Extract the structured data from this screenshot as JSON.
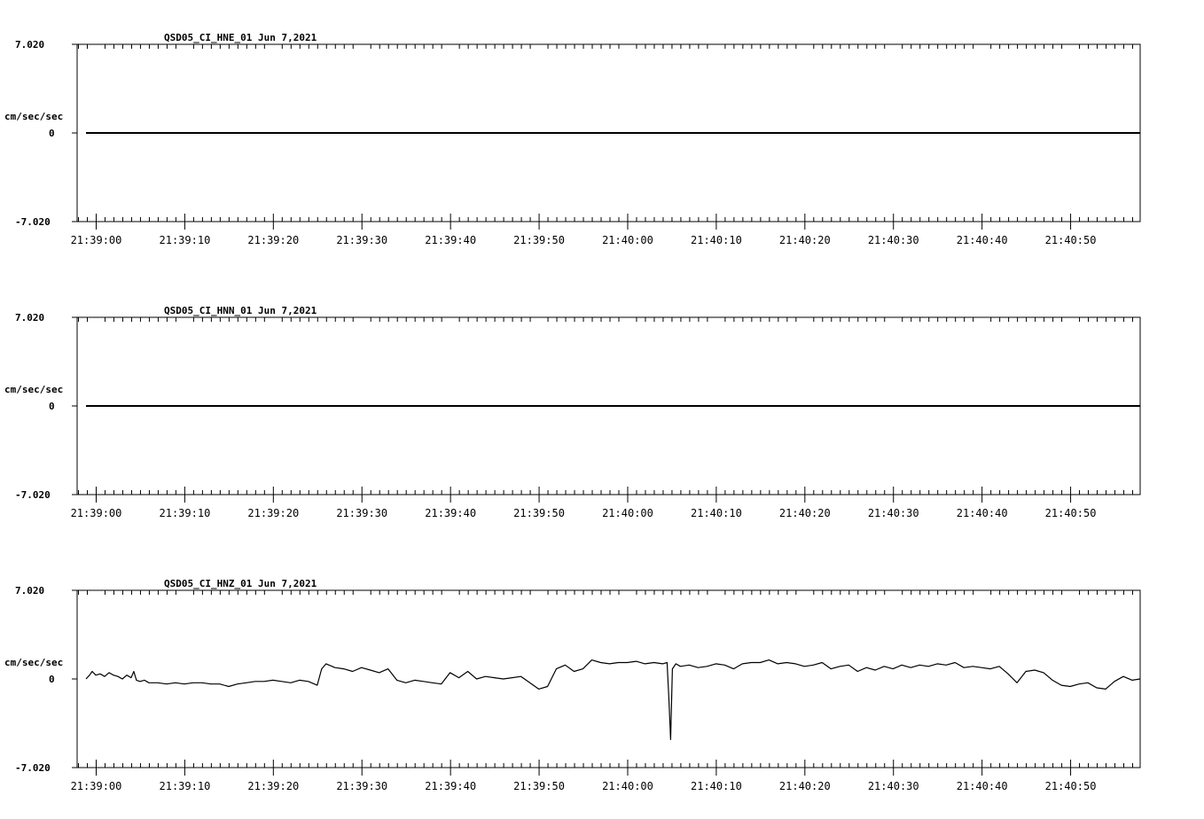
{
  "chart_data": [
    {
      "type": "line",
      "title": "QSD05_CI_HNE_01  Jun 7,2021",
      "ylabel": "cm/sec/sec",
      "ylim": [
        -7.02,
        7.02
      ],
      "y_ticks": [
        "7.020",
        "0",
        "-7.020"
      ],
      "x_ticks": [
        "21:39:00",
        "21:39:10",
        "21:39:20",
        "21:39:30",
        "21:39:40",
        "21:39:50",
        "21:40:00",
        "21:40:10",
        "21:40:20",
        "21:40:30",
        "21:40:40",
        "21:40:50"
      ],
      "xlim_seconds_after_21_38_59": [
        -1.1,
        118.9
      ],
      "series": [
        {
          "points": [
            [
              -0.1,
              0.0
            ],
            [
              118.9,
              0.0
            ]
          ]
        }
      ]
    },
    {
      "type": "line",
      "title": "QSD05_CI_HNN_01  Jun 7,2021",
      "ylabel": "cm/sec/sec",
      "ylim": [
        -7.02,
        7.02
      ],
      "y_ticks": [
        "7.020",
        "0",
        "-7.020"
      ],
      "x_ticks": [
        "21:39:00",
        "21:39:10",
        "21:39:20",
        "21:39:30",
        "21:39:40",
        "21:39:50",
        "21:40:00",
        "21:40:10",
        "21:40:20",
        "21:40:30",
        "21:40:40",
        "21:40:50"
      ],
      "xlim_seconds_after_21_38_59": [
        -1.1,
        118.9
      ],
      "series": [
        {
          "points": [
            [
              -0.1,
              0.0
            ],
            [
              118.9,
              0.0
            ]
          ]
        }
      ]
    },
    {
      "type": "line",
      "title": "QSD05_CI_HNZ_01  Jun 7,2021",
      "ylabel": "cm/sec/sec",
      "ylim": [
        -7.02,
        7.02
      ],
      "y_ticks": [
        "7.020",
        "0",
        "-7.020"
      ],
      "x_ticks": [
        "21:39:00",
        "21:39:10",
        "21:39:20",
        "21:39:30",
        "21:39:40",
        "21:39:50",
        "21:40:00",
        "21:40:10",
        "21:40:20",
        "21:40:30",
        "21:40:40",
        "21:40:50"
      ],
      "xlim_seconds_after_21_38_59": [
        -1.1,
        118.9
      ],
      "series": [
        {
          "points": [
            [
              -0.1,
              0.0
            ],
            [
              0.3,
              0.3
            ],
            [
              0.6,
              0.6
            ],
            [
              1.0,
              0.3
            ],
            [
              1.5,
              0.4
            ],
            [
              2.0,
              0.2
            ],
            [
              2.5,
              0.5
            ],
            [
              3.0,
              0.3
            ],
            [
              3.5,
              0.2
            ],
            [
              4.0,
              0.0
            ],
            [
              4.5,
              0.3
            ],
            [
              5.0,
              0.1
            ],
            [
              5.3,
              0.6
            ],
            [
              5.6,
              -0.1
            ],
            [
              6.0,
              -0.2
            ],
            [
              6.5,
              -0.1
            ],
            [
              7.0,
              -0.3
            ],
            [
              8.0,
              -0.3
            ],
            [
              9.0,
              -0.4
            ],
            [
              10.0,
              -0.3
            ],
            [
              11.0,
              -0.4
            ],
            [
              12.0,
              -0.3
            ],
            [
              13.0,
              -0.3
            ],
            [
              14.0,
              -0.4
            ],
            [
              15.0,
              -0.4
            ],
            [
              16.0,
              -0.6
            ],
            [
              17.0,
              -0.4
            ],
            [
              18.0,
              -0.3
            ],
            [
              19.0,
              -0.2
            ],
            [
              20.0,
              -0.2
            ],
            [
              21.0,
              -0.1
            ],
            [
              22.0,
              -0.2
            ],
            [
              23.0,
              -0.3
            ],
            [
              24.0,
              -0.1
            ],
            [
              25.0,
              -0.2
            ],
            [
              26.0,
              -0.5
            ],
            [
              26.5,
              0.8
            ],
            [
              27.0,
              1.2
            ],
            [
              28.0,
              0.9
            ],
            [
              29.0,
              0.8
            ],
            [
              30.0,
              0.6
            ],
            [
              31.0,
              0.9
            ],
            [
              32.0,
              0.7
            ],
            [
              33.0,
              0.5
            ],
            [
              34.0,
              0.8
            ],
            [
              35.0,
              -0.1
            ],
            [
              36.0,
              -0.3
            ],
            [
              37.0,
              -0.1
            ],
            [
              38.0,
              -0.2
            ],
            [
              39.0,
              -0.3
            ],
            [
              40.0,
              -0.4
            ],
            [
              41.0,
              0.5
            ],
            [
              42.0,
              0.1
            ],
            [
              43.0,
              0.6
            ],
            [
              44.0,
              0.0
            ],
            [
              45.0,
              0.2
            ],
            [
              46.0,
              0.1
            ],
            [
              47.0,
              0.0
            ],
            [
              48.0,
              0.1
            ],
            [
              49.0,
              0.2
            ],
            [
              50.0,
              -0.3
            ],
            [
              51.0,
              -0.8
            ],
            [
              52.0,
              -0.6
            ],
            [
              53.0,
              0.8
            ],
            [
              54.0,
              1.1
            ],
            [
              55.0,
              0.6
            ],
            [
              56.0,
              0.8
            ],
            [
              57.0,
              1.5
            ],
            [
              58.0,
              1.3
            ],
            [
              59.0,
              1.2
            ],
            [
              60.0,
              1.3
            ],
            [
              61.0,
              1.3
            ],
            [
              62.0,
              1.4
            ],
            [
              63.0,
              1.2
            ],
            [
              64.0,
              1.3
            ],
            [
              65.0,
              1.2
            ],
            [
              65.5,
              1.3
            ],
            [
              65.7,
              -1.5
            ],
            [
              65.9,
              -4.8
            ],
            [
              66.1,
              0.8
            ],
            [
              66.5,
              1.2
            ],
            [
              67.0,
              1.0
            ],
            [
              68.0,
              1.1
            ],
            [
              69.0,
              0.9
            ],
            [
              70.0,
              1.0
            ],
            [
              71.0,
              1.2
            ],
            [
              72.0,
              1.1
            ],
            [
              73.0,
              0.8
            ],
            [
              74.0,
              1.2
            ],
            [
              75.0,
              1.3
            ],
            [
              76.0,
              1.3
            ],
            [
              77.0,
              1.5
            ],
            [
              78.0,
              1.2
            ],
            [
              79.0,
              1.3
            ],
            [
              80.0,
              1.2
            ],
            [
              81.0,
              1.0
            ],
            [
              82.0,
              1.1
            ],
            [
              83.0,
              1.3
            ],
            [
              84.0,
              0.8
            ],
            [
              85.0,
              1.0
            ],
            [
              86.0,
              1.1
            ],
            [
              87.0,
              0.6
            ],
            [
              88.0,
              0.9
            ],
            [
              89.0,
              0.7
            ],
            [
              90.0,
              1.0
            ],
            [
              91.0,
              0.8
            ],
            [
              92.0,
              1.1
            ],
            [
              93.0,
              0.9
            ],
            [
              94.0,
              1.1
            ],
            [
              95.0,
              1.0
            ],
            [
              96.0,
              1.2
            ],
            [
              97.0,
              1.1
            ],
            [
              98.0,
              1.3
            ],
            [
              99.0,
              0.9
            ],
            [
              100.0,
              1.0
            ],
            [
              101.0,
              0.9
            ],
            [
              102.0,
              0.8
            ],
            [
              103.0,
              1.0
            ],
            [
              104.0,
              0.4
            ],
            [
              105.0,
              -0.3
            ],
            [
              106.0,
              0.6
            ],
            [
              107.0,
              0.7
            ],
            [
              108.0,
              0.5
            ],
            [
              109.0,
              -0.1
            ],
            [
              110.0,
              -0.5
            ],
            [
              111.0,
              -0.6
            ],
            [
              112.0,
              -0.4
            ],
            [
              113.0,
              -0.3
            ],
            [
              114.0,
              -0.7
            ],
            [
              115.0,
              -0.8
            ],
            [
              116.0,
              -0.2
            ],
            [
              117.0,
              0.2
            ],
            [
              118.0,
              -0.1
            ],
            [
              118.9,
              0.0
            ]
          ]
        }
      ]
    }
  ]
}
